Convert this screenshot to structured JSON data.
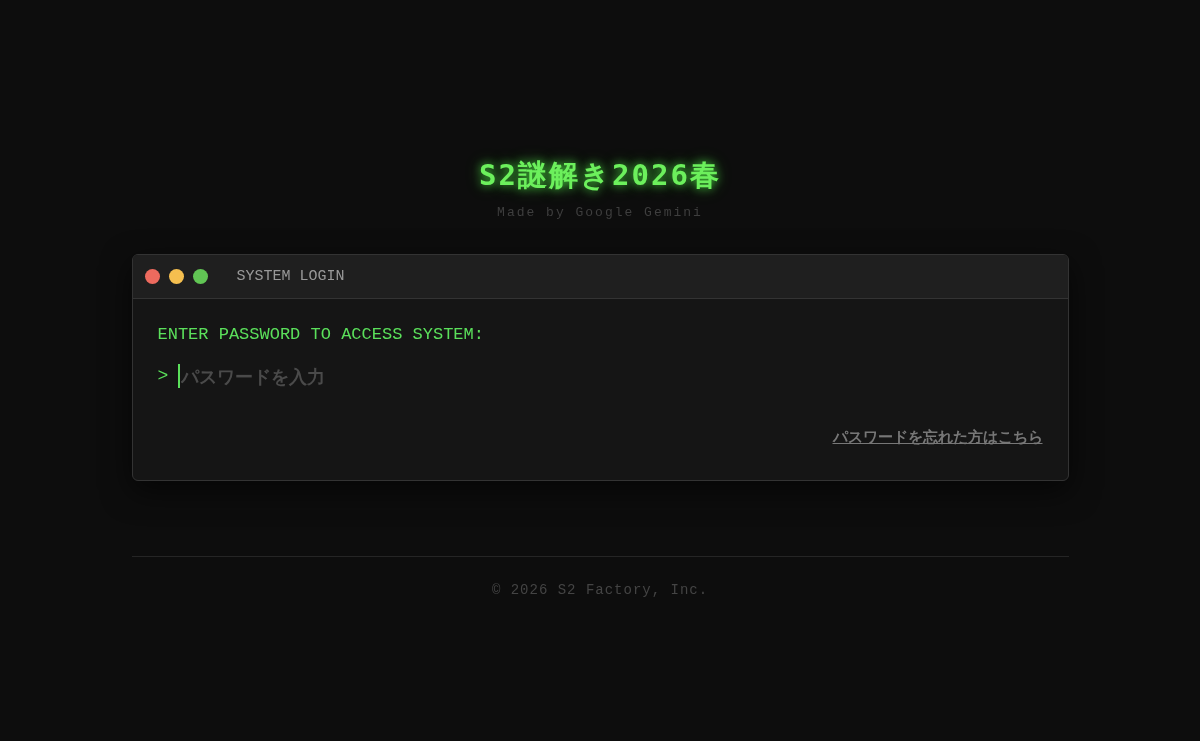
{
  "header": {
    "title": "S2謎解き2026春",
    "subtitle": "Made by Google Gemini"
  },
  "window": {
    "title": "SYSTEM LOGIN",
    "prompt_text": "ENTER PASSWORD TO ACCESS SYSTEM:",
    "prompt_symbol": ">",
    "password": {
      "placeholder": "パスワードを入力"
    },
    "forgot_link": "パスワードを忘れた方はこちら"
  },
  "footer": {
    "copyright": "© 2026 S2 Factory, Inc."
  }
}
